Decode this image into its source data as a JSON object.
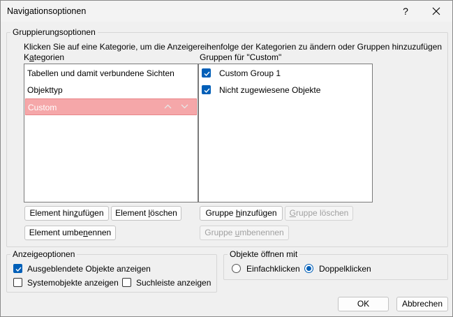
{
  "dialog": {
    "title": "Navigationsoptionen",
    "help_label": "?"
  },
  "grouping": {
    "legend": "Gruppierungsoptionen",
    "instruction": "Klicken Sie auf eine Kategorie, um die Anzeigereihenfolge der Kategorien zu ändern oder Gruppen hinzuzufügen",
    "categories_label": "Kategorien",
    "groups_label": "Gruppen für \"Custom\"",
    "categories": [
      {
        "label": "Tabellen und damit verbundene Sichten",
        "selected": false
      },
      {
        "label": "Objekttyp",
        "selected": false
      },
      {
        "label": "Custom",
        "selected": true
      }
    ],
    "groups": [
      {
        "label": "Custom Group 1",
        "checked": true
      },
      {
        "label": "Nicht zugewiesene Objekte",
        "checked": true
      }
    ],
    "buttons": {
      "add_element": "Element hinzufügen",
      "delete_element": "Element löschen",
      "rename_element": "Element umbenennen",
      "add_group": "Gruppe hinzufügen",
      "delete_group": "Gruppe löschen",
      "rename_group": "Gruppe umbenennen"
    }
  },
  "display_options": {
    "legend": "Anzeigeoptionen",
    "show_hidden": {
      "label": "Ausgeblendete Objekte anzeigen",
      "checked": true
    },
    "show_system": {
      "label": "Systemobjekte anzeigen",
      "checked": false
    },
    "show_search": {
      "label": "Suchleiste anzeigen",
      "checked": false
    }
  },
  "open_objects": {
    "legend": "Objekte öffnen mit",
    "single_click": {
      "label": "Einfachklicken",
      "checked": false
    },
    "double_click": {
      "label": "Doppelklicken",
      "checked": true
    }
  },
  "footer": {
    "ok": "OK",
    "cancel": "Abbrechen"
  },
  "colors": {
    "selection": "#f5a7a9",
    "accent": "#005fb8"
  }
}
